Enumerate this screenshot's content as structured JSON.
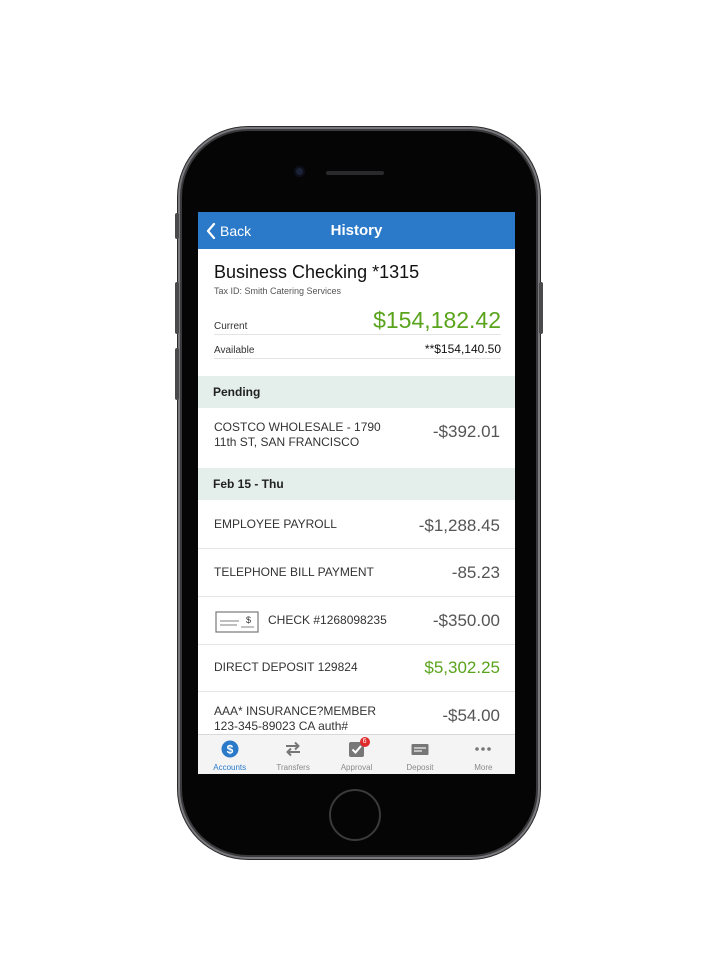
{
  "nav": {
    "back_label": "Back",
    "title": "History"
  },
  "account": {
    "name": "Business Checking *1315",
    "tax_id": "Tax ID: Smith Catering Services",
    "current_label": "Current",
    "current_amount": "$154,182.42",
    "available_label": "Available",
    "available_amount": "**$154,140.50"
  },
  "sections": {
    "pending": "Pending",
    "date": "Feb 15 - Thu"
  },
  "transactions": [
    {
      "desc": "COSTCO WHOLESALE - 1790 11th ST, SAN FRANCISCO",
      "amount": "-$392.01"
    },
    {
      "desc": "EMPLOYEE PAYROLL",
      "amount": "-$1,288.45"
    },
    {
      "desc": "TELEPHONE BILL PAYMENT",
      "amount": "-85.23"
    },
    {
      "desc": "CHECK #1268098235",
      "amount": "-$350.00"
    },
    {
      "desc": "DIRECT DEPOSIT 129824",
      "amount": "$5,302.25"
    },
    {
      "desc": "AAA* INSURANCE?MEMBER 123-345-89023 CA auth#",
      "amount": "-$54.00"
    }
  ],
  "tabs": [
    {
      "label": "Accounts",
      "icon": "dollar-icon"
    },
    {
      "label": "Transfers",
      "icon": "transfer-arrows-icon"
    },
    {
      "label": "Approval",
      "icon": "approval-check-icon",
      "badge": "6"
    },
    {
      "label": "Deposit",
      "icon": "deposit-check-icon"
    },
    {
      "label": "More",
      "icon": "more-dots-icon"
    }
  ],
  "colors": {
    "header": "#2a7ac9",
    "positive": "#5aa41d",
    "section_bg": "#e4efeb",
    "badge": "#e02b2b"
  }
}
